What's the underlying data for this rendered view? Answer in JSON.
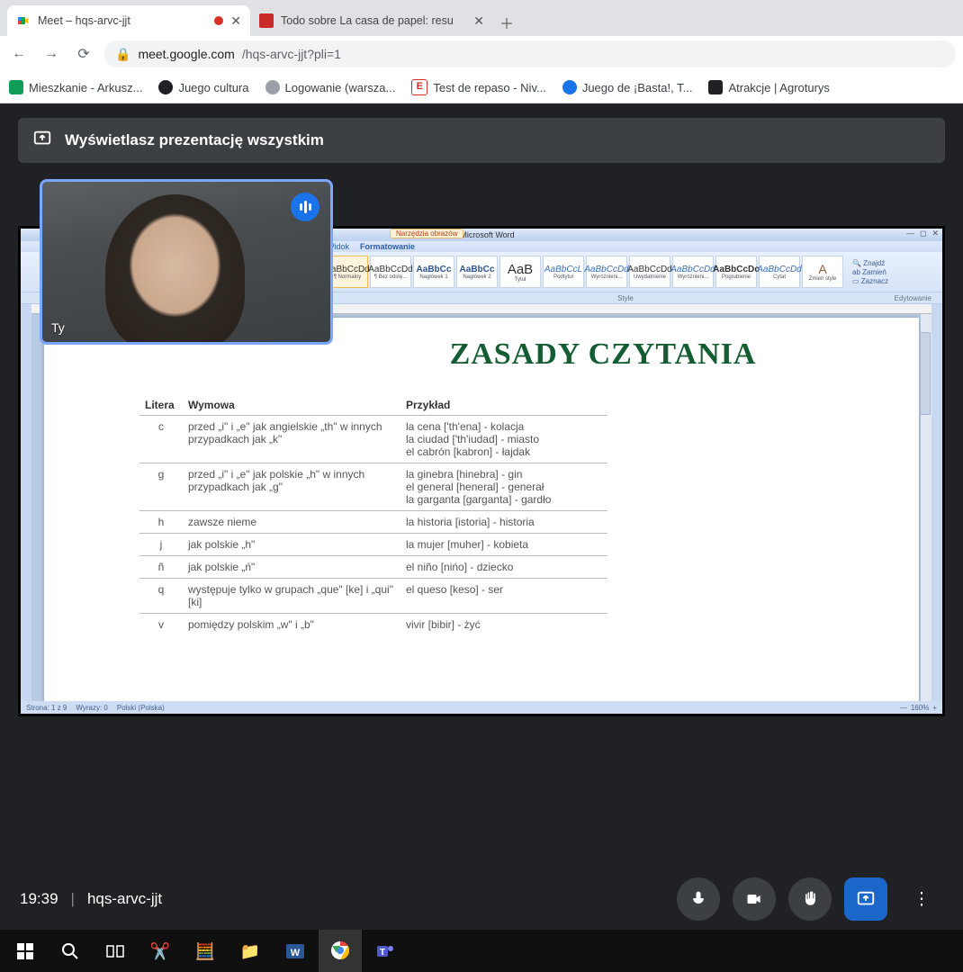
{
  "tabs": [
    {
      "title": "Meet – hqs-arvc-jjt"
    },
    {
      "title": "Todo sobre La casa de papel: resu"
    }
  ],
  "url": {
    "domain": "meet.google.com",
    "path": "/hqs-arvc-jjt?pli=1"
  },
  "bookmarks": [
    {
      "label": "Mieszkanie - Arkusz...",
      "color": "#0f9d58"
    },
    {
      "label": "Juego cultura",
      "color": "#202124"
    },
    {
      "label": "Logowanie (warsza...",
      "color": "#9aa0a6"
    },
    {
      "label": "Test de repaso - Niv...",
      "color": "#d93025"
    },
    {
      "label": "Juego de ¡Basta!, T...",
      "color": "#1a73e8"
    },
    {
      "label": "Atrakcje | Agroturys",
      "color": "#202124"
    }
  ],
  "banner": "Wyświetlasz prezentację wszystkim",
  "selfview_label": "Ty",
  "word": {
    "title": "1 - Microsoft Word",
    "tools": "Narzędzia obrazów",
    "tabs": {
      "widok": "Widok",
      "formatowanie": "Formatowanie"
    },
    "styles": [
      {
        "sample": "AaBbCcDd",
        "name": "¶ Normalny"
      },
      {
        "sample": "AaBbCcDd",
        "name": "¶ Bez odstę..."
      },
      {
        "sample": "AaBbCc",
        "name": "Nagłówek 1"
      },
      {
        "sample": "AaBbCc",
        "name": "Nagłówek 2"
      },
      {
        "sample": "AaB",
        "name": "Tytuł"
      },
      {
        "sample": "AaBbCcL",
        "name": "Podtytuł"
      },
      {
        "sample": "AaBbCcDd",
        "name": "Wyróżnieni..."
      },
      {
        "sample": "AaBbCcDd",
        "name": "Uwydatnienie"
      },
      {
        "sample": "AaBbCcDd",
        "name": "Wyróżnieni..."
      },
      {
        "sample": "AaBbCcDc",
        "name": "Pogrubienie"
      },
      {
        "sample": "AaBbCcDd",
        "name": "Cytat"
      }
    ],
    "zmien_style": "Zmień style",
    "editing": {
      "find": "Znajdź",
      "replace": "Zamień",
      "select": "Zaznacz"
    },
    "groups": {
      "style": "Style",
      "editing": "Edytowanie"
    },
    "status": {
      "page": "Strona: 1 z 9",
      "words": "Wyrazy: 0",
      "lang": "Polski (Polska)",
      "zoom": "160%"
    }
  },
  "doc": {
    "title": "ZASADY CZYTANIA",
    "headers": {
      "litera": "Litera",
      "wymowa": "Wymowa",
      "przyklad": "Przykład"
    },
    "rows": [
      {
        "l": "c",
        "w": "przed „i\" i „e\" jak angielskie „th\" w innych przypadkach jak „k\"",
        "p": "la cena ['th'ena] - kolacja\nla ciudad ['th'iudad] - miasto\nel cabrón [kabron] - łajdak"
      },
      {
        "l": "g",
        "w": "przed „i\" i „e\" jak polskie „h\" w innych przypadkach jak „g\"",
        "p": "la ginebra [hinebra] - gin\nel general [heneral] - generał\nla garganta [garganta] - gardło"
      },
      {
        "l": "h",
        "w": "zawsze nieme",
        "p": "la historia [istoria] - historia"
      },
      {
        "l": "j",
        "w": "jak polskie „h\"",
        "p": "la mujer [muher] - kobieta"
      },
      {
        "l": "ñ",
        "w": "jak polskie „ń\"",
        "p": "el niño [nińo] - dziecko"
      },
      {
        "l": "q",
        "w": "występuje tylko w grupach „que\" [ke] i „qui\" [ki]",
        "p": "el queso [keso] - ser"
      },
      {
        "l": "v",
        "w": "pomiędzy polskim „w\" i „b\"",
        "p": "vivir [bibir] - żyć"
      }
    ]
  },
  "meet_footer": {
    "time": "19:39",
    "code": "hqs-arvc-jjt"
  }
}
